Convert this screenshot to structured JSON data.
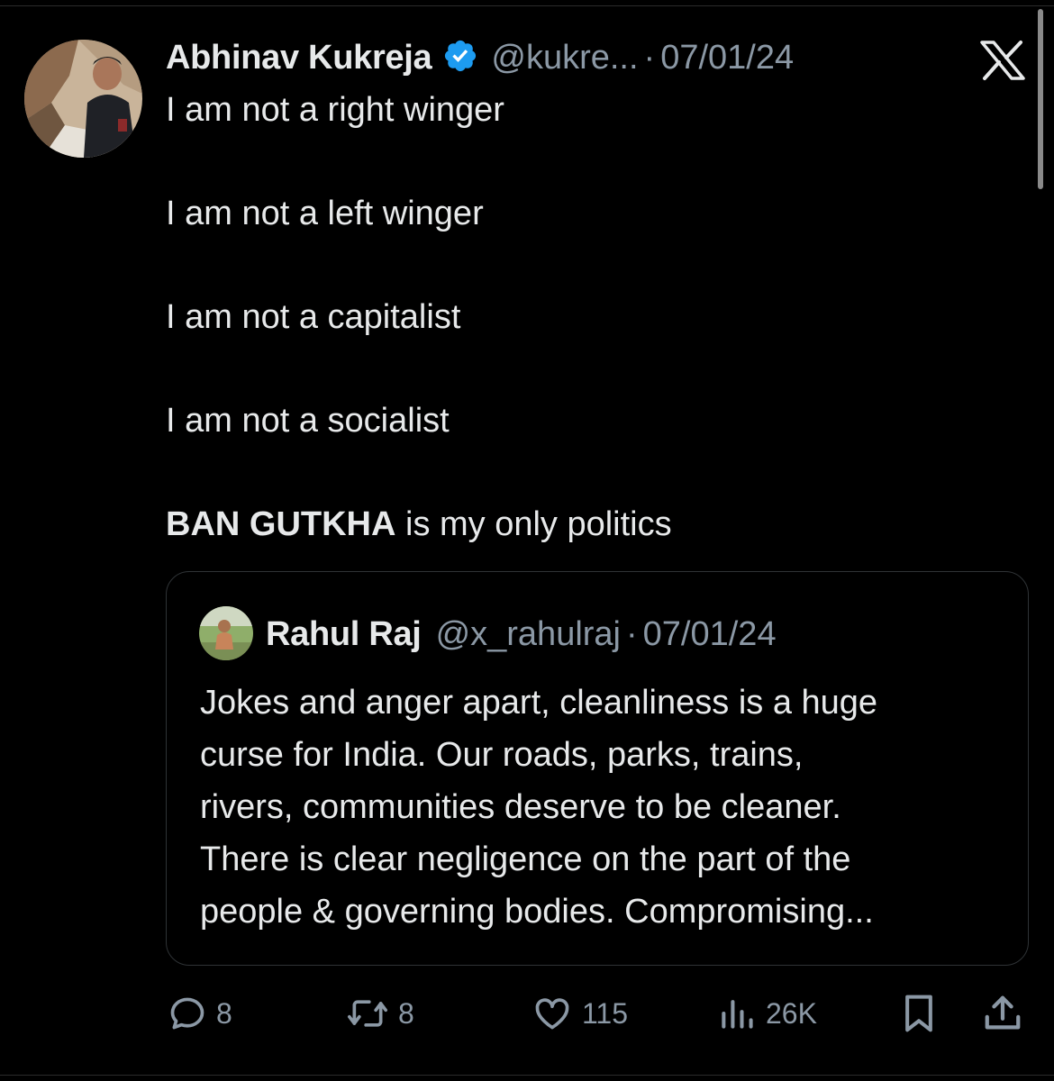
{
  "tweet": {
    "author_name": "Abhinav Kukreja",
    "author_handle": "@kukre...",
    "separator": "·",
    "date": "07/01/24",
    "lines": [
      "I am not a right winger",
      "I am not a left winger",
      "I am not a capitalist",
      "I am not a socialist"
    ],
    "last_line_bold": "BAN GUTKHA",
    "last_line_rest": " is my only politics"
  },
  "quoted_tweet": {
    "author_name": "Rahul Raj",
    "author_handle": "@x_rahulraj",
    "separator": "·",
    "date": "07/01/24",
    "lines": [
      "Jokes and anger apart, cleanliness is a huge",
      "curse for India. Our roads, parks, trains,",
      "rivers, communities deserve to be cleaner.",
      "There is clear negligence on the part of the",
      "people & governing bodies. Compromising..."
    ]
  },
  "actions": {
    "replies": "8",
    "reposts": "8",
    "likes": "115",
    "views": "26K"
  },
  "icons": {
    "verified": "verified-badge-icon",
    "platform": "x-logo-icon",
    "reply": "reply-icon",
    "repost": "repost-icon",
    "like": "heart-icon",
    "views": "views-icon",
    "bookmark": "bookmark-icon",
    "share": "share-icon"
  },
  "colors": {
    "background": "#000000",
    "text": "#e7e9ea",
    "secondary_text": "#8b98a5",
    "verified_blue": "#1d9bf0",
    "border": "#2f3336"
  }
}
